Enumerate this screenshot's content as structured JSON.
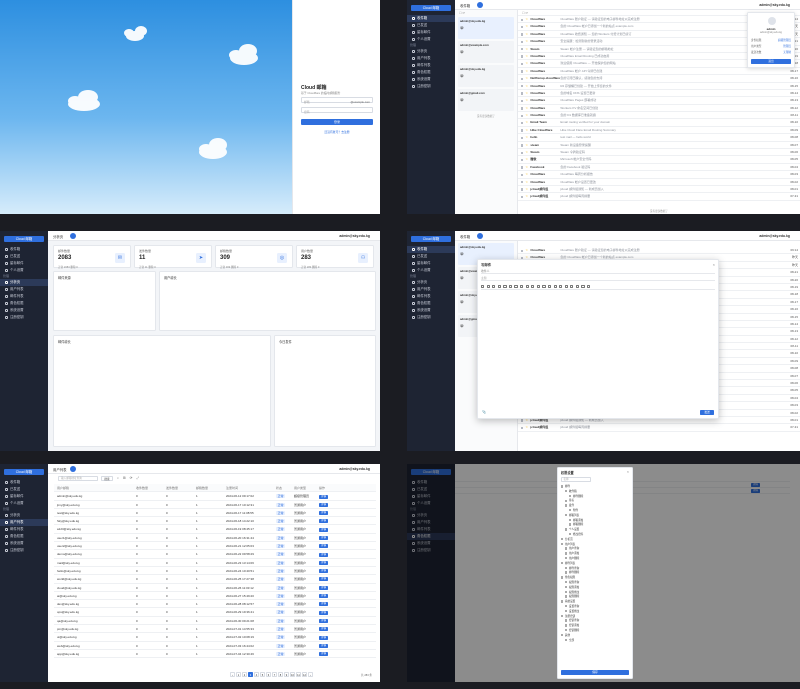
{
  "login": {
    "title": "Cloud 邮箱",
    "subtitle": "基于 Cloudflare 的临时邮箱服务",
    "email_placeholder": "邮箱",
    "domain": "@example.com",
    "password_placeholder": "密码",
    "submit": "登录",
    "register_link": "还没有账号？去注册"
  },
  "brand": "Cloud 邮箱",
  "inbox": {
    "title": "收件箱",
    "user": "admin@sky.edu.kg",
    "accounts": [
      {
        "addr": "admin@sky.edu.kg",
        "sel": true
      },
      {
        "addr": "admin@example.com",
        "sel": false
      },
      {
        "addr": "admin@sky.edu.kg",
        "sel": false
      },
      {
        "addr": "admin@gmail.com",
        "sel": false
      }
    ],
    "load_more": "没有更多数据了",
    "popover": {
      "name": "admin",
      "email": "admin@sky.edu.kg",
      "rows": [
        [
          "身份权限",
          "超级管理员"
        ],
        [
          "用户类型",
          "管理员"
        ],
        [
          "发送次数",
          "无限制"
        ]
      ],
      "logout": "退出"
    },
    "mails": [
      {
        "from": "Cloudflare",
        "subject": "Cloudflare 账户验证 — 请验证您的电子邮件地址以完成注册",
        "date": "09:14"
      },
      {
        "from": "Cloudflare",
        "subject": "您的 Cloudflare 帐户已添加一个新的站点 example.com",
        "date": "昨天"
      },
      {
        "from": "Cloudflare",
        "subject": "Cloudflare 收费通知 — 您的 Workers 付费计划已续订",
        "date": "昨天"
      },
      {
        "from": "Cloudflare",
        "subject": "安全提醒：检测到新的登录活动",
        "date": "08-21"
      },
      {
        "from": "Steam",
        "subject": "Steam 帐户注册 — 请验证您的邮箱地址",
        "date": "08-20"
      },
      {
        "from": "Cloudflare",
        "subject": "Cloudflare Email Routing 已成功启用",
        "date": "08-19"
      },
      {
        "from": "Cloudflare",
        "subject": "欢迎使用 Cloudflare — 开始保护您的网站",
        "date": "08-18"
      },
      {
        "from": "Cloudflare",
        "subject": "Cloudflare 帐户 API 令牌已创建",
        "date": "08-17"
      },
      {
        "from": "Netflixcup.cloudflare",
        "subject": "您的订阅已确认，感谢您的支持",
        "date": "08-16"
      },
      {
        "from": "Cloudflare",
        "subject": "R2 存储桶已创建 — 开始上传您的文件",
        "date": "08-15"
      },
      {
        "from": "Cloudflare",
        "subject": "您的域名 DNS 设置已更新",
        "date": "08-14"
      },
      {
        "from": "Cloudflare",
        "subject": "Cloudflare Pages 部署成功",
        "date": "08-13"
      },
      {
        "from": "Cloudflare",
        "subject": "Workers KV 命名空间已创建",
        "date": "08-12"
      },
      {
        "from": "Cloudflare",
        "subject": "您的 D1 数据库已准备就绪",
        "date": "08-11"
      },
      {
        "from": "Email Team",
        "subject": "Email routing verified for your domain",
        "date": "08-10"
      },
      {
        "from": "Hike Cloudflare",
        "subject": "Hike Cloud Flare Email Routing Summary",
        "date": "08-09"
      },
      {
        "from": "hello",
        "subject": "test mail — hello world",
        "date": "08-08"
      },
      {
        "from": "steam",
        "subject": "Steam 新设备登录提醒",
        "date": "08-07"
      },
      {
        "from": "Steam",
        "subject": "Steam 令牌验证码",
        "date": "08-06"
      },
      {
        "from": "微软",
        "subject": "Microsoft 帐户安全代码",
        "date": "08-05"
      },
      {
        "from": "Facebook",
        "subject": "您的 Facebook 验证码",
        "date": "08-04"
      },
      {
        "from": "Cloudflare",
        "subject": "Cloudflare 每周分析报告",
        "date": "08-03"
      },
      {
        "from": "Cloudflare",
        "subject": "Cloudflare 帐户设置已更改",
        "date": "08-02"
      },
      {
        "from": "jcloud邮件组",
        "subject": "jcloud 邮件组通知 — 新成员加入",
        "date": "08-01"
      },
      {
        "from": "jcloud邮件组",
        "subject": "jcloud 邮件组每周摘要",
        "date": "07-31"
      }
    ]
  },
  "sidebar": {
    "top": [
      {
        "label": "收件箱",
        "icon": "inbox-icon"
      },
      {
        "label": "已发送",
        "icon": "send-icon"
      },
      {
        "label": "星标邮件",
        "icon": "star-icon"
      },
      {
        "label": "个人设置",
        "icon": "user-icon"
      }
    ],
    "section": "管理",
    "admin": [
      {
        "label": "分析页",
        "icon": "chart-icon"
      },
      {
        "label": "用户列表",
        "icon": "users-icon"
      },
      {
        "label": "邮件列表",
        "icon": "mail-icon"
      },
      {
        "label": "角色权限",
        "icon": "shield-icon"
      },
      {
        "label": "系统设置",
        "icon": "gear-icon"
      },
      {
        "label": "注册密钥",
        "icon": "key-icon"
      }
    ]
  },
  "dashboard": {
    "title": "分析页",
    "user": "admin@sky.edu.kg",
    "stats": [
      {
        "label": "邮件数量",
        "value": "2083",
        "sub": "正常 2083  删除 0",
        "icon": "✉"
      },
      {
        "label": "发件数量",
        "value": "11",
        "sub": "正常 11  删除 0",
        "icon": "➤"
      },
      {
        "label": "邮箱数量",
        "value": "309",
        "sub": "正常 309  删除 0",
        "icon": "◎"
      },
      {
        "label": "用户数量",
        "value": "283",
        "sub": "正常 283  删除 0",
        "icon": "⚇"
      }
    ],
    "donut_title": "邮件来源",
    "line_title": "用户增长",
    "bar_title": "邮件增长",
    "gauge_title": "今日发件",
    "bar_legend": [
      "接收",
      "发送"
    ]
  },
  "compose": {
    "title": "写邮件",
    "to_label": "收件人",
    "subject_placeholder": "主题",
    "send": "发送"
  },
  "users": {
    "title": "用户列表",
    "search_placeholder": "输入邮箱地址查询",
    "search_button": "搜索",
    "user": "admin@sky.edu.kg",
    "headers": [
      "用户邮箱",
      "收件数量",
      "发件数量",
      "邮箱数量",
      "注册时间",
      "状态",
      "用户类型",
      "操作"
    ],
    "rows": [
      [
        "admin@sky.edu.kg",
        "0",
        "0",
        "1",
        "2024-06-12 09:17:02",
        "正常",
        "超级管理员",
        "详情"
      ],
      [
        "jimy@sky.edu.kg",
        "0",
        "0",
        "1",
        "2024-06-17 10:12:31",
        "正常",
        "普通用户",
        "详情"
      ],
      [
        "test@sky.edu.kg",
        "0",
        "0",
        "1",
        "2024-06-17 11:08:55",
        "正常",
        "普通用户",
        "详情"
      ],
      [
        "Sky@sky.edu.kg",
        "0",
        "0",
        "1",
        "2024-06-18 14:22:10",
        "正常",
        "普通用户",
        "详情"
      ],
      [
        "a123@sky.edu.kg",
        "0",
        "0",
        "1",
        "2024-06-19 08:45:17",
        "正常",
        "普通用户",
        "详情"
      ],
      [
        "user1@sky.edu.kg",
        "0",
        "0",
        "1",
        "2024-06-20 16:31:44",
        "正常",
        "普通用户",
        "详情"
      ],
      [
        "user2@sky.edu.kg",
        "0",
        "0",
        "1",
        "2024-06-21 12:05:03",
        "正常",
        "普通用户",
        "详情"
      ],
      [
        "demo@sky.edu.kg",
        "0",
        "0",
        "1",
        "2024-06-22 09:58:29",
        "正常",
        "普通用户",
        "详情"
      ],
      [
        "mail@sky.edu.kg",
        "0",
        "0",
        "1",
        "2024-06-23 13:14:06",
        "正常",
        "普通用户",
        "详情"
      ],
      [
        "hello@sky.edu.kg",
        "0",
        "0",
        "1",
        "2024-06-24 10:40:51",
        "正常",
        "普通用户",
        "详情"
      ],
      [
        "world@sky.edu.kg",
        "0",
        "0",
        "1",
        "2024-06-25 17:27:38",
        "正常",
        "普通用户",
        "详情"
      ],
      [
        "cloud@sky.edu.kg",
        "0",
        "0",
        "1",
        "2024-06-26 11:03:12",
        "正常",
        "普通用户",
        "详情"
      ],
      [
        "ai@sky.edu.kg",
        "0",
        "0",
        "1",
        "2024-06-27 15:49:20",
        "正常",
        "普通用户",
        "详情"
      ],
      [
        "dev@sky.edu.kg",
        "0",
        "0",
        "1",
        "2024-06-28 08:12:57",
        "正常",
        "普通用户",
        "详情"
      ],
      [
        "ops@sky.edu.kg",
        "0",
        "0",
        "1",
        "2024-06-29 19:36:41",
        "正常",
        "普通用户",
        "详情"
      ],
      [
        "qa@sky.edu.kg",
        "0",
        "0",
        "1",
        "2024-06-30 09:21:08",
        "正常",
        "普通用户",
        "详情"
      ],
      [
        "pm@sky.edu.kg",
        "0",
        "0",
        "1",
        "2024-07-01 14:55:33",
        "正常",
        "普通用户",
        "详情"
      ],
      [
        "ui@sky.edu.kg",
        "0",
        "0",
        "1",
        "2024-07-02 10:08:19",
        "正常",
        "普通用户",
        "详情"
      ],
      [
        "web@sky.edu.kg",
        "0",
        "0",
        "1",
        "2024-07-03 16:44:02",
        "正常",
        "普通用户",
        "详情"
      ],
      [
        "app@sky.edu.kg",
        "0",
        "0",
        "1",
        "2024-07-04 12:30:46",
        "正常",
        "普通用户",
        "详情"
      ]
    ],
    "pages": [
      "1",
      "2",
      "3",
      "4",
      "5",
      "6",
      "7",
      "8",
      "9",
      "10",
      "11",
      "12"
    ],
    "total": "共 283 条"
  },
  "perm": {
    "title": "权限设置",
    "name_label": "名称",
    "confirm": "保存",
    "tree": [
      [
        "邮件",
        0
      ],
      [
        "收件箱",
        1
      ],
      [
        "邮件删除",
        2
      ],
      [
        "星标",
        1
      ],
      [
        "发件",
        1
      ],
      [
        "附件",
        2
      ],
      [
        "邮箱列表",
        1
      ],
      [
        "邮箱添加",
        2
      ],
      [
        "邮箱删除",
        2
      ],
      [
        "个人设置",
        1
      ],
      [
        "修改密码",
        2
      ],
      [
        "分析页",
        0
      ],
      [
        "用户列表",
        0
      ],
      [
        "用户查询",
        1
      ],
      [
        "用户添加",
        1
      ],
      [
        "用户删除",
        1
      ],
      [
        "邮件列表",
        0
      ],
      [
        "邮件查询",
        1
      ],
      [
        "邮件删除",
        1
      ],
      [
        "角色权限",
        0
      ],
      [
        "权限查询",
        1
      ],
      [
        "权限添加",
        1
      ],
      [
        "权限修改",
        1
      ],
      [
        "权限删除",
        1
      ],
      [
        "系统设置",
        0
      ],
      [
        "设置查询",
        1
      ],
      [
        "设置修改",
        1
      ],
      [
        "注册密钥",
        0
      ],
      [
        "密钥查询",
        1
      ],
      [
        "密钥添加",
        1
      ],
      [
        "密钥删除",
        1
      ],
      [
        "其他",
        0
      ],
      [
        "全部",
        1
      ]
    ]
  }
}
